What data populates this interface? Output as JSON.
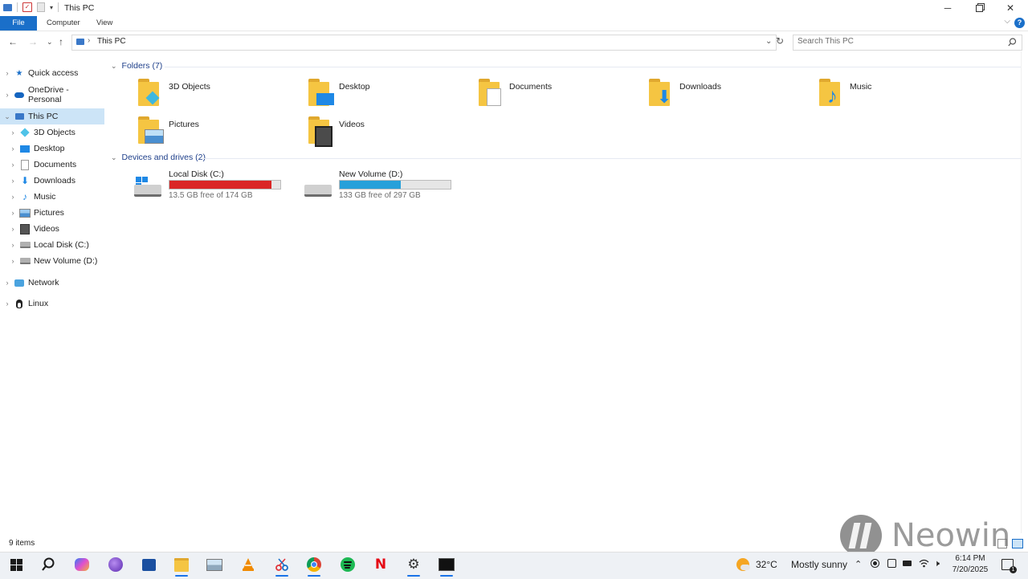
{
  "window": {
    "title": "This PC"
  },
  "ribbon": {
    "tabs": [
      "File",
      "Computer",
      "View"
    ]
  },
  "navigation": {
    "breadcrumb": "This PC",
    "search_placeholder": "Search This PC"
  },
  "sidebar": {
    "items": [
      {
        "label": "Quick access",
        "icon": "star-icon"
      },
      {
        "label": "OneDrive - Personal",
        "icon": "cloud-icon"
      },
      {
        "label": "This PC",
        "icon": "computer-icon",
        "selected": true
      },
      {
        "label": "3D Objects",
        "icon": "cube-icon"
      },
      {
        "label": "Desktop",
        "icon": "desktop-icon"
      },
      {
        "label": "Documents",
        "icon": "document-icon"
      },
      {
        "label": "Downloads",
        "icon": "download-icon"
      },
      {
        "label": "Music",
        "icon": "music-icon"
      },
      {
        "label": "Pictures",
        "icon": "picture-icon"
      },
      {
        "label": "Videos",
        "icon": "video-icon"
      },
      {
        "label": "Local Disk (C:)",
        "icon": "drive-icon"
      },
      {
        "label": "New Volume (D:)",
        "icon": "drive-icon"
      },
      {
        "label": "Network",
        "icon": "network-icon"
      },
      {
        "label": "Linux",
        "icon": "penguin-icon"
      }
    ]
  },
  "content": {
    "folders_header": "Folders (7)",
    "folders": [
      {
        "label": "3D Objects",
        "overlay": "cube-icon"
      },
      {
        "label": "Desktop",
        "overlay": "desktop-icon"
      },
      {
        "label": "Documents",
        "overlay": "document-icon"
      },
      {
        "label": "Downloads",
        "overlay": "download-icon"
      },
      {
        "label": "Music",
        "overlay": "music-icon"
      },
      {
        "label": "Pictures",
        "overlay": "picture-icon"
      },
      {
        "label": "Videos",
        "overlay": "video-icon"
      }
    ],
    "drives_header": "Devices and drives (2)",
    "drives": [
      {
        "name": "Local Disk (C:)",
        "free": "13.5 GB free of 174 GB",
        "used_fraction": 0.922,
        "color": "#da2626"
      },
      {
        "name": "New Volume (D:)",
        "free": "133 GB free of 297 GB",
        "used_fraction": 0.552,
        "color": "#26a0da"
      }
    ]
  },
  "status_bar": {
    "items_count": "9 items"
  },
  "taskbar": {
    "weather_temp": "32°C",
    "weather_desc": "Mostly sunny",
    "time": "6:14 PM",
    "date": "7/20/2025",
    "apps": [
      "windows-start-icon",
      "search-icon",
      "copilot-icon",
      "browser-icon",
      "store-icon",
      "file-explorer-icon",
      "photos-icon",
      "vlc-icon",
      "snipping-icon",
      "chrome-icon",
      "spotify-icon",
      "netflix-icon",
      "settings-icon",
      "terminal-icon"
    ]
  },
  "watermark": {
    "text": "Neowin"
  },
  "colors": {
    "accent": "#1a6fc9",
    "selection": "#cce4f7",
    "drive_c": "#da2626",
    "drive_d": "#26a0da",
    "folder": "#f5c542"
  }
}
